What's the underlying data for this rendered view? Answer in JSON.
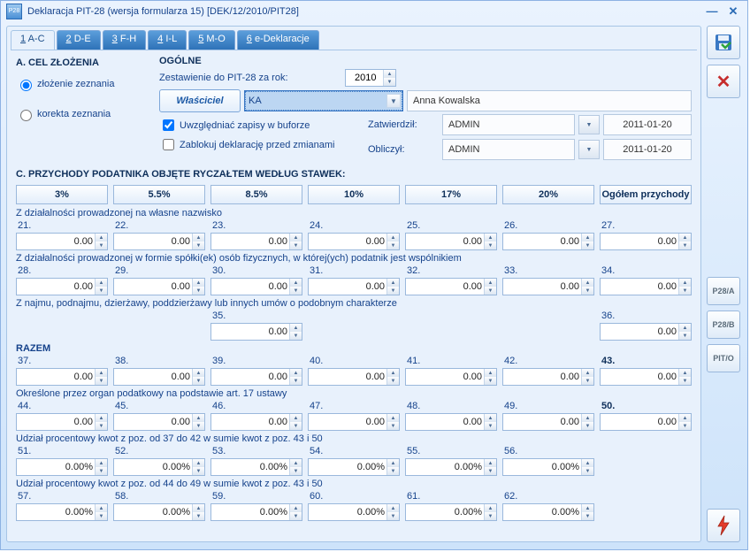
{
  "window": {
    "icon_text": "P28",
    "title": "Deklaracja PIT-28 (wersja formularza 15) [DEK/12/2010/PIT28]"
  },
  "tabs": [
    {
      "u": "1",
      "rest": " A-C",
      "active": true
    },
    {
      "u": "2",
      "rest": " D-E"
    },
    {
      "u": "3",
      "rest": " F-H"
    },
    {
      "u": "4",
      "rest": " I-L"
    },
    {
      "u": "5",
      "rest": " M-O"
    },
    {
      "u": "6",
      "rest": " e-Deklaracje"
    }
  ],
  "sectionA": {
    "title": "A. CEL ZŁOŻENIA",
    "radios": [
      {
        "label": "złożenie zeznania",
        "checked": true
      },
      {
        "label": "korekta zeznania",
        "checked": false
      }
    ]
  },
  "general": {
    "title": "OGÓLNE",
    "year_label": "Zestawienie do PIT-28 za rok:",
    "year": "2010",
    "owner_button": "Właściciel",
    "owner_code": "KA",
    "owner_name": "Anna Kowalska",
    "chk_buffer": {
      "label": "Uwzględniać zapisy w buforze",
      "checked": true
    },
    "chk_lock": {
      "label": "Zablokuj deklarację przed zmianami",
      "checked": false
    },
    "approved_label": "Zatwierdził:",
    "computed_label": "Obliczył:",
    "approved_by": "ADMIN",
    "approved_date": "2011-01-20",
    "computed_by": "ADMIN",
    "computed_date": "2011-01-20"
  },
  "sectionC": {
    "title": "C. PRZYCHODY PODATNIKA OBJĘTE RYCZAŁTEM WEDŁUG STAWEK:",
    "rates": [
      "3%",
      "5.5%",
      "8.5%",
      "10%",
      "17%",
      "20%",
      "Ogółem przychody"
    ],
    "groups": [
      {
        "label": "Z działalności prowadzonej na własne nazwisko",
        "cells": [
          {
            "n": "21.",
            "v": "0.00"
          },
          {
            "n": "22.",
            "v": "0.00"
          },
          {
            "n": "23.",
            "v": "0.00"
          },
          {
            "n": "24.",
            "v": "0.00"
          },
          {
            "n": "25.",
            "v": "0.00"
          },
          {
            "n": "26.",
            "v": "0.00"
          },
          {
            "n": "27.",
            "v": "0.00"
          }
        ]
      },
      {
        "label": "Z działalności prowadzonej w formie spółki(ek) osób fizycznych, w której(ych) podatnik jest wspólnikiem",
        "cells": [
          {
            "n": "28.",
            "v": "0.00"
          },
          {
            "n": "29.",
            "v": "0.00"
          },
          {
            "n": "30.",
            "v": "0.00"
          },
          {
            "n": "31.",
            "v": "0.00"
          },
          {
            "n": "32.",
            "v": "0.00"
          },
          {
            "n": "33.",
            "v": "0.00"
          },
          {
            "n": "34.",
            "v": "0.00"
          }
        ]
      },
      {
        "label": "Z najmu, podnajmu, dzierżawy, poddzierżawy lub innych umów o podobnym charakterze",
        "cells": [
          null,
          null,
          {
            "n": "35.",
            "v": "0.00"
          },
          null,
          null,
          null,
          {
            "n": "36.",
            "v": "0.00"
          }
        ]
      },
      {
        "label": "RAZEM",
        "bold": true,
        "cells": [
          {
            "n": "37.",
            "v": "0.00"
          },
          {
            "n": "38.",
            "v": "0.00"
          },
          {
            "n": "39.",
            "v": "0.00"
          },
          {
            "n": "40.",
            "v": "0.00"
          },
          {
            "n": "41.",
            "v": "0.00"
          },
          {
            "n": "42.",
            "v": "0.00"
          },
          {
            "n": "43.",
            "v": "0.00",
            "bold": true
          }
        ]
      },
      {
        "label": "Określone przez organ podatkowy na podstawie art. 17 ustawy",
        "cells": [
          {
            "n": "44.",
            "v": "0.00"
          },
          {
            "n": "45.",
            "v": "0.00"
          },
          {
            "n": "46.",
            "v": "0.00"
          },
          {
            "n": "47.",
            "v": "0.00"
          },
          {
            "n": "48.",
            "v": "0.00"
          },
          {
            "n": "49.",
            "v": "0.00"
          },
          {
            "n": "50.",
            "v": "0.00",
            "bold": true
          }
        ]
      },
      {
        "label": "Udział procentowy kwot z poz. od 37 do 42 w sumie kwot z poz. 43 i 50",
        "cells": [
          {
            "n": "51.",
            "v": "0.00%"
          },
          {
            "n": "52.",
            "v": "0.00%"
          },
          {
            "n": "53.",
            "v": "0.00%"
          },
          {
            "n": "54.",
            "v": "0.00%"
          },
          {
            "n": "55.",
            "v": "0.00%"
          },
          {
            "n": "56.",
            "v": "0.00%"
          },
          null
        ]
      },
      {
        "label": "Udział procentowy kwot z poz. od 44 do 49 w sumie kwot z poz. 43 i 50",
        "cells": [
          {
            "n": "57.",
            "v": "0.00%"
          },
          {
            "n": "58.",
            "v": "0.00%"
          },
          {
            "n": "59.",
            "v": "0.00%"
          },
          {
            "n": "60.",
            "v": "0.00%"
          },
          {
            "n": "61.",
            "v": "0.00%"
          },
          {
            "n": "62.",
            "v": "0.00%"
          },
          null
        ]
      }
    ]
  },
  "side": {
    "p28a": "P28/A",
    "p28b": "P28/B",
    "pito": "PIT/O"
  }
}
